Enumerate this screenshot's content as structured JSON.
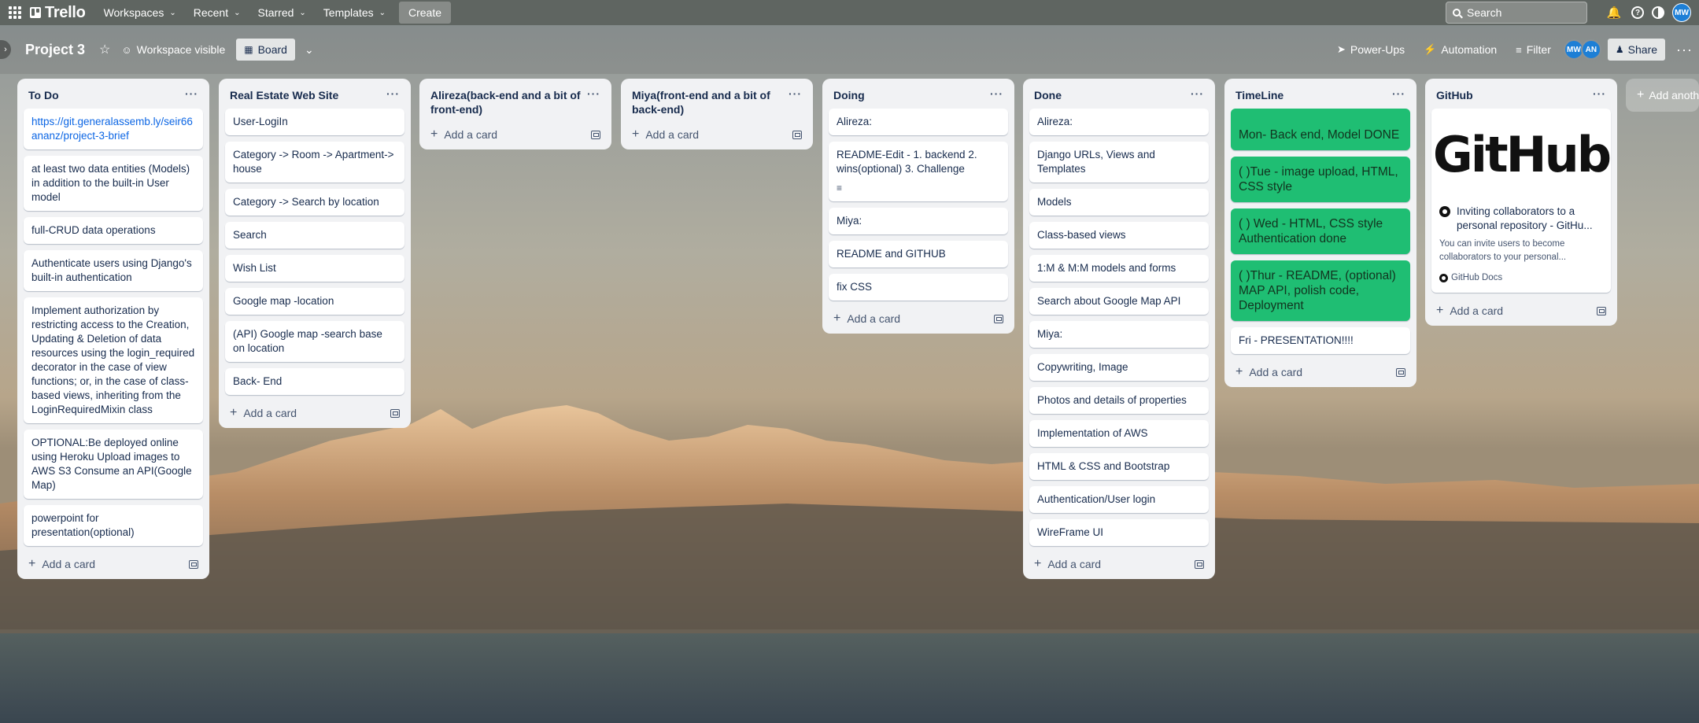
{
  "topnav": {
    "brand": "Trello",
    "menus": [
      {
        "label": "Workspaces"
      },
      {
        "label": "Recent"
      },
      {
        "label": "Starred"
      },
      {
        "label": "Templates"
      }
    ],
    "create_label": "Create",
    "search_placeholder": "Search",
    "user_initials": "MW"
  },
  "board": {
    "title": "Project 3",
    "visibility": "Workspace visible",
    "view_label": "Board",
    "powerups": "Power-Ups",
    "automation": "Automation",
    "filter": "Filter",
    "members": [
      "MW",
      "AN"
    ],
    "share": "Share",
    "add_list": "Add another list"
  },
  "lists": [
    {
      "title": "To Do",
      "cards": [
        {
          "text": "https://git.generalassemb.ly/seir66ananz/project-3-brief",
          "link": true
        },
        {
          "text": "at least two data entities (Models) in addition to the built-in User model"
        },
        {
          "text": "full-CRUD data operations"
        },
        {
          "text": "Authenticate users using Django's built-in authentication"
        },
        {
          "text": "Implement authorization by restricting access to the Creation, Updating & Deletion of data resources using the login_required decorator in the case of view functions; or, in the case of class-based views, inheriting from the LoginRequiredMixin class"
        },
        {
          "text": "OPTIONAL:Be deployed online using Heroku Upload images to AWS S3 Consume an API(Google Map)"
        },
        {
          "text": "powerpoint for presentation(optional)"
        }
      ],
      "add_label": "Add a card"
    },
    {
      "title": "Real Estate Web Site",
      "cards": [
        {
          "text": "User-LogiIn"
        },
        {
          "text": "Category -> Room -> Apartment-> house"
        },
        {
          "text": "Category -> Search by location"
        },
        {
          "text": "Search"
        },
        {
          "text": "Wish List"
        },
        {
          "text": "Google map -location"
        },
        {
          "text": "(API) Google map -search base on location"
        },
        {
          "text": "Back- End"
        }
      ],
      "add_label": "Add a card"
    },
    {
      "title": "Alireza(back-end and a bit of front-end)",
      "cards": [],
      "add_label": "Add a card"
    },
    {
      "title": "Miya(front-end and a bit of back-end)",
      "cards": [],
      "add_label": "Add a card"
    },
    {
      "title": "Doing",
      "cards": [
        {
          "text": "Alireza:"
        },
        {
          "text": "README-Edit - 1. backend 2. wins(optional) 3. Challenge",
          "desc": true
        },
        {
          "text": "Miya:"
        },
        {
          "text": "README and GITHUB"
        },
        {
          "text": "fix CSS"
        }
      ],
      "add_label": "Add a card"
    },
    {
      "title": "Done",
      "cards": [
        {
          "text": "Alireza:"
        },
        {
          "text": "Django URLs, Views and Templates"
        },
        {
          "text": "Models"
        },
        {
          "text": "Class-based views"
        },
        {
          "text": "1:M & M:M models and forms"
        },
        {
          "text": "Search about Google Map API"
        },
        {
          "text": "Miya:"
        },
        {
          "text": "Copywriting, Image"
        },
        {
          "text": "Photos and details of properties"
        },
        {
          "text": "Implementation of AWS"
        },
        {
          "text": "HTML & CSS and Bootstrap"
        },
        {
          "text": "Authentication/User login"
        },
        {
          "text": "WireFrame UI"
        }
      ],
      "add_label": "Add a card"
    },
    {
      "title": "TimeLine",
      "cards": [
        {
          "text": "Mon- Back end, Model DONE",
          "green": true
        },
        {
          "text": "( )Tue - image upload, HTML, CSS style",
          "green": true
        },
        {
          "text": "( ) Wed - HTML, CSS style Authentication done",
          "green": true
        },
        {
          "text": "( )Thur - README, (optional) MAP API, polish code, Deployment",
          "green": true
        },
        {
          "text": "Fri - PRESENTATION!!!!"
        }
      ],
      "add_label": "Add a card"
    },
    {
      "title": "GitHub",
      "github": {
        "logo": "GitHub",
        "title": "Inviting collaborators to a personal repository - GitHu...",
        "desc": "You can invite users to become collaborators to your personal...",
        "source": "GitHub Docs"
      },
      "cards": [],
      "add_label": "Add a card"
    }
  ],
  "colors": {
    "topnav": "#5f6561",
    "list_bg": "#f1f2f4",
    "green_card": "#1fbe73",
    "link": "#0c66e4",
    "avatar": "#1d7fd6"
  }
}
